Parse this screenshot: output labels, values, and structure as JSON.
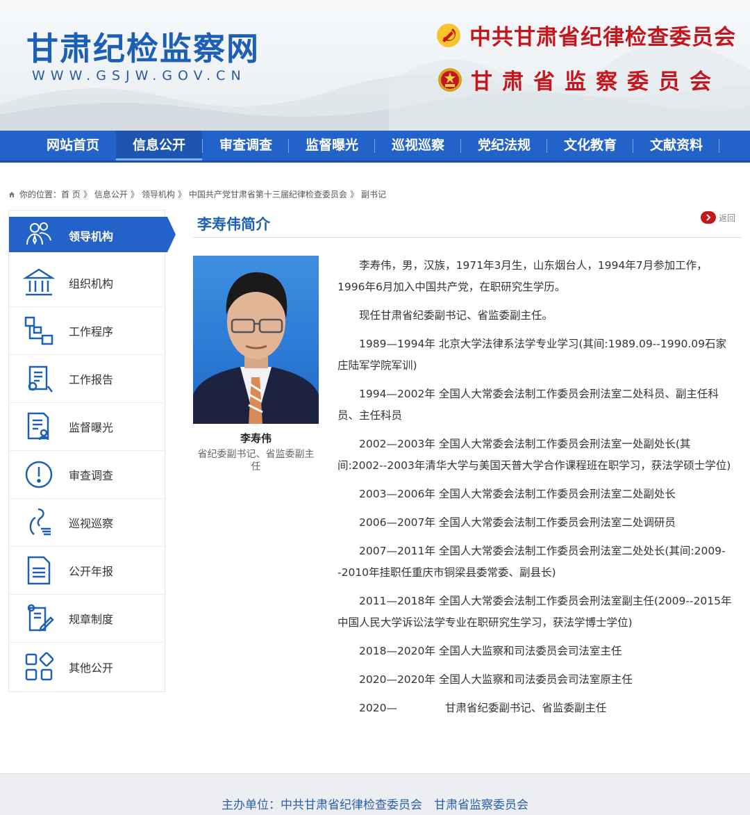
{
  "header": {
    "site_title": "甘肃纪检监察网",
    "site_url": "WWW.GSJW.GOV.CN",
    "org_line_1": "中共甘肃省纪律检查委员会",
    "org_line_2": "甘肃省监察委员会"
  },
  "nav": {
    "items": [
      {
        "label": "网站首页"
      },
      {
        "label": "信息公开"
      },
      {
        "label": "审查调查"
      },
      {
        "label": "监督曝光"
      },
      {
        "label": "巡视巡察"
      },
      {
        "label": "党纪法规"
      },
      {
        "label": "文化教育"
      },
      {
        "label": "文献资料"
      }
    ],
    "active_index": 1
  },
  "breadcrumb": {
    "prefix": "你的位置：",
    "items": [
      "首 页",
      "信息公开",
      "领导机构",
      "中国共产党甘肃省第十三届纪律检查委员会",
      "副书记"
    ],
    "separator": "》"
  },
  "sidebar": {
    "items": [
      {
        "label": "领导机构",
        "icon": "leaders-icon"
      },
      {
        "label": "组织机构",
        "icon": "building-icon"
      },
      {
        "label": "工作程序",
        "icon": "flow-icon"
      },
      {
        "label": "工作报告",
        "icon": "report-icon"
      },
      {
        "label": "监督曝光",
        "icon": "supervise-icon"
      },
      {
        "label": "审查调查",
        "icon": "alert-icon"
      },
      {
        "label": "巡视巡察",
        "icon": "inspect-icon"
      },
      {
        "label": "公开年报",
        "icon": "document-icon"
      },
      {
        "label": "规章制度",
        "icon": "rules-icon"
      },
      {
        "label": "其他公开",
        "icon": "grid-icon"
      }
    ],
    "active_index": 0
  },
  "content": {
    "title": "李寿伟简介",
    "back_label": "返回",
    "photo_name": "李寿伟",
    "photo_caption": "省纪委副书记、省监委副主任",
    "bio": [
      "李寿伟，男，汉族，1971年3月生，山东烟台人，1994年7月参加工作，1996年6月加入中国共产党，在职研究生学历。",
      "现任甘肃省纪委副书记、省监委副主任。",
      "1989—1994年  北京大学法律系法学专业学习(其间:1989.09--1990.09石家庄陆军学院军训)",
      "1994—2002年  全国人大常委会法制工作委员会刑法室二处科员、副主任科员、主任科员",
      "2002—2003年  全国人大常委会法制工作委员会刑法室一处副处长(其间:2002--2003年清华大学与美国天普大学合作课程班在职学习，获法学硕士学位)",
      "2003—2006年  全国人大常委会法制工作委员会刑法室二处副处长",
      "2006—2007年  全国人大常委会法制工作委员会刑法室二处调研员",
      "2007—2011年  全国人大常委会法制工作委员会刑法室二处处长(其间:2009--2010年挂职任重庆市铜梁县委常委、副县长)",
      "2011—2018年  全国人大常委会法制工作委员会刑法室副主任(2009--2015年中国人民大学诉讼法学专业在职研究生学习，获法学博士学位)",
      "2018—2020年  全国人大监察和司法委员会司法室主任",
      "2020—2020年  全国人大监察和司法委员会司法室原主任",
      "2020—              甘肃省纪委副书记、省监委副主任"
    ]
  },
  "footer": {
    "text": "主办单位：中共甘肃省纪律检查委员会　甘肃省监察委员会"
  },
  "colors": {
    "primary_blue": "#2363c9",
    "title_blue": "#1d5fb4",
    "party_red": "#c4171d"
  }
}
